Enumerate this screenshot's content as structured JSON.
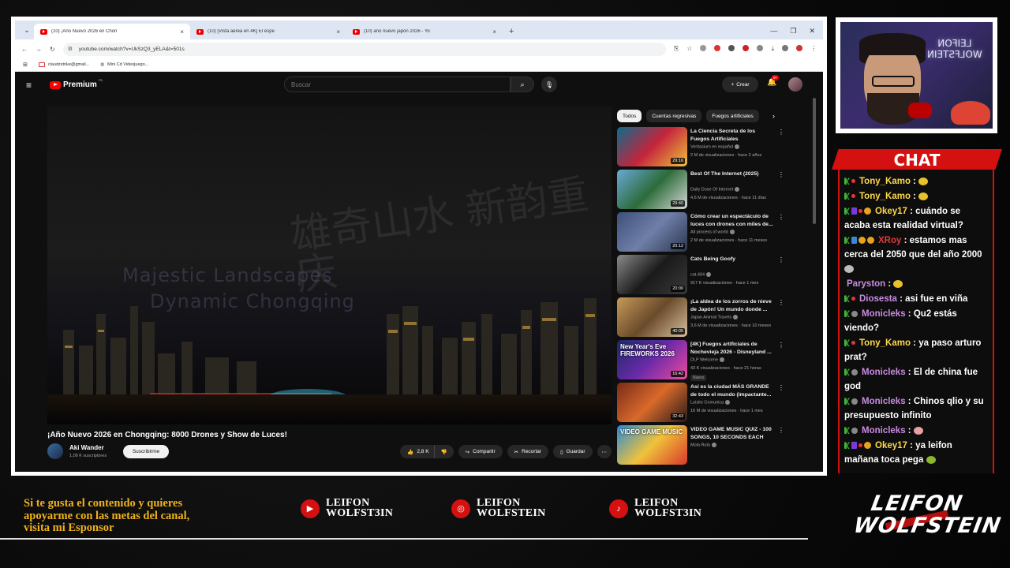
{
  "browser": {
    "tabs": [
      {
        "title": "(10) ¡Año Nuevo 2026 en Chon",
        "active": true
      },
      {
        "title": "(10) [Vista aérea en 4K] El espe",
        "active": false
      },
      {
        "title": "(10) año nuevo japon 2026 - Yo",
        "active": false
      }
    ],
    "url": "youtube.com/watch?v=UkSzQ3_yELA&t=501s",
    "bookmarks": [
      {
        "label": "claudzstrike@gmail..."
      },
      {
        "label": "Mini Cd Videojuego..."
      }
    ]
  },
  "youtube": {
    "logo_text": "Premium",
    "logo_region": "CL",
    "search_placeholder": "Buscar",
    "create_label": "Crear",
    "notif_count": "9+",
    "video": {
      "watermark_line1": "Majestic Landscapes",
      "watermark_line2": "Dynamic Chongqing",
      "kanji": "雄奇山水 新韵重庆",
      "title": "¡Año Nuevo 2026 en Chongqing: 8000 Drones y Show de Luces!",
      "channel": "Aki Wander",
      "subscribers": "1,09 K suscriptores",
      "subscribe_label": "Suscribirme",
      "likes": "2,8 K",
      "share_label": "Compartir",
      "clip_label": "Recortar",
      "save_label": "Guardar"
    },
    "chips": [
      "Todos",
      "Cuentas regresivas",
      "Fuegos artificiales"
    ],
    "recommended": [
      {
        "title": "La Ciencia Secreta de los Fuegos Artificiales",
        "channel": "Veritasium en español",
        "meta": "2 M de visualizaciones · hace 2 años",
        "duration": "29:16",
        "thumb": "linear-gradient(135deg,#0d6b8a,#c4243c,#f0c23a)"
      },
      {
        "title": "Best Of The Internet (2025)",
        "channel": "Daily Dose Of Internet",
        "meta": "4,6 M de visualizaciones · hace 11 días",
        "duration": "29:40",
        "thumb": "linear-gradient(135deg,#6aa8d8,#2c6c3a,#d8d8d8)"
      },
      {
        "title": "Cómo crear un espectáculo de luces con drones con miles de...",
        "channel": "All process of world",
        "meta": "2 M de visualizaciones · hace 11 meses",
        "duration": "20:12",
        "thumb": "linear-gradient(135deg,#3d4f7a,#6f7fa8,#2b3550)"
      },
      {
        "title": "Cats Being Goofy",
        "channel": "cat.404",
        "meta": "917 K visualizaciones · hace 1 mes",
        "duration": "20:00",
        "thumb": "linear-gradient(135deg,#8a8a8a,#1a1a1a,#3a3a3a)"
      },
      {
        "title": "¡La aldea de los zorros de nieve de Japón! Un mundo donde ...",
        "channel": "Japan Animal Travels",
        "meta": "3,6 M de visualizaciones · hace 10 meses",
        "duration": "40:05",
        "thumb": "linear-gradient(135deg,#c79a5a,#6a4a2a,#d8c0a0)"
      },
      {
        "title": "[4K] Fuegos artificiales de Nochevieja 2026 - Disneyland ...",
        "channel": "DLP Welcome",
        "meta": "43 K visualizaciones · hace 21 horas",
        "duration": "16:42",
        "thumb": "linear-gradient(135deg,#1a2a6a,#6a2aa8,#f04aa0)",
        "new": "Nuevo",
        "thumb_text": "New Year's Eve FIREWORKS 2026"
      },
      {
        "title": "Así es la ciudad MÁS GRANDE de todo el mundo (impactante...",
        "channel": "Luisito Comunica",
        "meta": "16 M de visualizaciones · hace 1 mes",
        "duration": "32:43",
        "thumb": "linear-gradient(135deg,#7a2a1a,#d86a2a,#2a1a1a)"
      },
      {
        "title": "VIDEO GAME MUSIC QUIZ - 100 SONGS, 10 SECONDS EACH",
        "channel": "Mola Ruta",
        "meta": "",
        "duration": "",
        "thumb": "linear-gradient(135deg,#2a8ad8,#f0c23a,#d83a2a)",
        "thumb_text": "VIDEO GAME MUSIC"
      }
    ]
  },
  "webcam": {
    "neon_line1": "LEIFON",
    "neon_line2": "WOLFSTEIN"
  },
  "chat": {
    "title": "CHAT",
    "messages": [
      {
        "user": "Tony_Kamo",
        "text": "",
        "badges": [
          "green",
          "red"
        ],
        "color": "gold",
        "emoji": "#e8c22a"
      },
      {
        "user": "Tony_Kamo",
        "text": "",
        "badges": [
          "green",
          "red"
        ],
        "color": "gold",
        "emoji": "#e8c22a"
      },
      {
        "user": "Okey17",
        "text": "cuándo se acaba esta realidad virtual?",
        "badges": [
          "green",
          "purple",
          "red",
          "gold"
        ],
        "color": "gold"
      },
      {
        "user": "XRoy",
        "text": "estamos mas cerca del 2050 que del año 2000",
        "badges": [
          "green",
          "blue",
          "gold",
          "gold"
        ],
        "color": "red",
        "emoji": "#bbbbbb"
      },
      {
        "user": "Paryston",
        "text": "",
        "badges": [],
        "color": "pink",
        "emoji": "#e8c22a"
      },
      {
        "user": "Diosesta",
        "text": "asi fue en viña",
        "badges": [
          "green",
          "red"
        ],
        "color": "pink"
      },
      {
        "user": "Monicleks",
        "text": "Qu2 estás viendo?",
        "badges": [
          "green",
          "gray"
        ],
        "color": "pink"
      },
      {
        "user": "Tony_Kamo",
        "text": "ya paso arturo prat?",
        "badges": [
          "green",
          "red"
        ],
        "color": "gold"
      },
      {
        "user": "Monicleks",
        "text": "El de china fue god",
        "badges": [
          "green",
          "gray"
        ],
        "color": "pink"
      },
      {
        "user": "Monicleks",
        "text": "Chinos qlio y su presupuesto infinito",
        "badges": [
          "green",
          "gray"
        ],
        "color": "pink"
      },
      {
        "user": "Monicleks",
        "text": "",
        "badges": [
          "green",
          "gray"
        ],
        "color": "pink",
        "emoji": "#e8a0a0"
      },
      {
        "user": "Okey17",
        "text": "ya leifon mañana toca pega",
        "badges": [
          "green",
          "purple",
          "red",
          "gold"
        ],
        "color": "gold",
        "emoji": "#8ab82a"
      }
    ]
  },
  "footer": {
    "promo_line1": "Si te gusta el contenido y quieres",
    "promo_line2": "apoyarme con las metas del canal,",
    "promo_line3": "visita mi Esponsor",
    "social": [
      {
        "network": "youtube-icon",
        "line1": "LEIFON",
        "line2": "WOLFST3IN"
      },
      {
        "network": "instagram-icon",
        "line1": "LEIFON",
        "line2": "WOLFSTEIN"
      },
      {
        "network": "tiktok-icon",
        "line1": "LEIFON",
        "line2": "WOLFST3IN"
      }
    ],
    "brand_line1": "LEIFON",
    "brand_line2": "WOLFSTEIN"
  }
}
